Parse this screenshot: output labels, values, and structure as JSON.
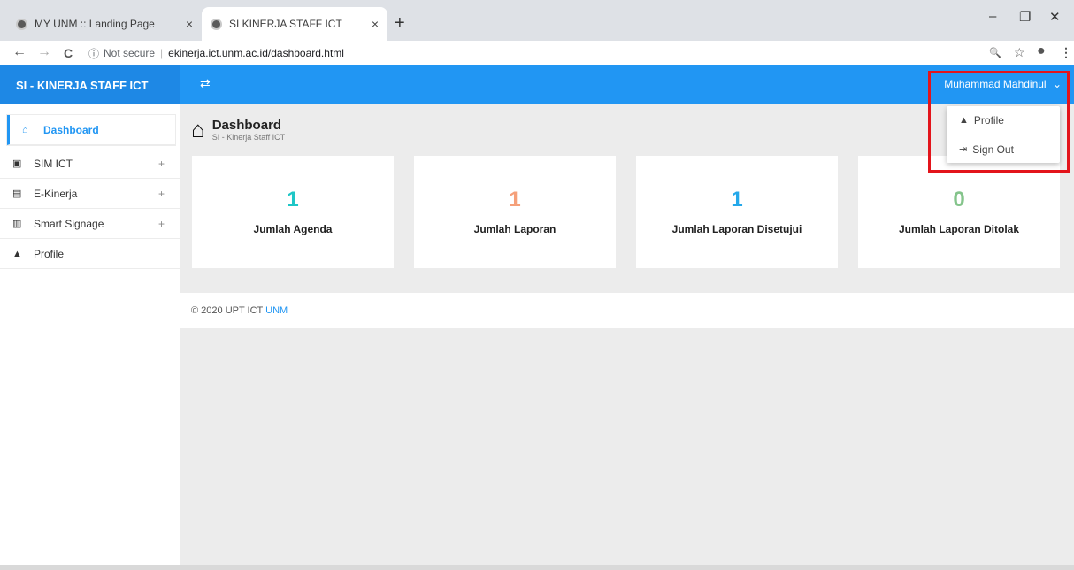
{
  "browser": {
    "tabs": [
      {
        "title": "MY UNM :: Landing Page",
        "close": "×"
      },
      {
        "title": "SI KINERJA STAFF ICT",
        "close": "×"
      }
    ],
    "new_tab": "+",
    "window_controls": {
      "minimize": "–",
      "restore": "❐",
      "close": "✕"
    },
    "nav": {
      "back": "←",
      "forward": "→",
      "reload": "C"
    },
    "address": {
      "security_icon": "ⓘ",
      "security": "Not secure",
      "separator": "|",
      "url": "ekinerja.ict.unm.ac.id/dashboard.html"
    },
    "right_icons": {
      "zoom": "🔍",
      "star": "☆",
      "account": "●",
      "menu": "⋮"
    }
  },
  "header": {
    "brand": "SI - KINERJA STAFF ICT",
    "toggle_icon": "⇄",
    "user": "Muhammad Mahdinul",
    "user_caret": "⌄"
  },
  "user_menu": [
    {
      "icon": "▲",
      "label": "Profile"
    },
    {
      "icon": "⇥",
      "label": "Sign Out"
    }
  ],
  "sidebar": {
    "items": [
      {
        "icon": "⌂",
        "label": "Dashboard",
        "expand": ""
      },
      {
        "icon": "▣",
        "label": "SIM ICT",
        "expand": "+"
      },
      {
        "icon": "▤",
        "label": "E-Kinerja",
        "expand": "+"
      },
      {
        "icon": "▥",
        "label": "Smart Signage",
        "expand": "+"
      },
      {
        "icon": "▲",
        "label": "Profile",
        "expand": ""
      }
    ]
  },
  "page": {
    "title": "Dashboard",
    "subtitle": "SI - Kinerja Staff ICT",
    "home_icon": "⌂"
  },
  "cards": [
    {
      "value": "1",
      "label": "Jumlah Agenda",
      "color": "#1ec6c6"
    },
    {
      "value": "1",
      "label": "Jumlah Laporan",
      "color": "#f5a07a"
    },
    {
      "value": "1",
      "label": "Jumlah Laporan Disetujui",
      "color": "#24a8ea"
    },
    {
      "value": "0",
      "label": "Jumlah Laporan Ditolak",
      "color": "#84c48b"
    }
  ],
  "footer": {
    "text": "© 2020 UPT ICT ",
    "link": "UNM"
  },
  "colors": {
    "accent": "#2196f3",
    "highlight": "#e3141b"
  }
}
